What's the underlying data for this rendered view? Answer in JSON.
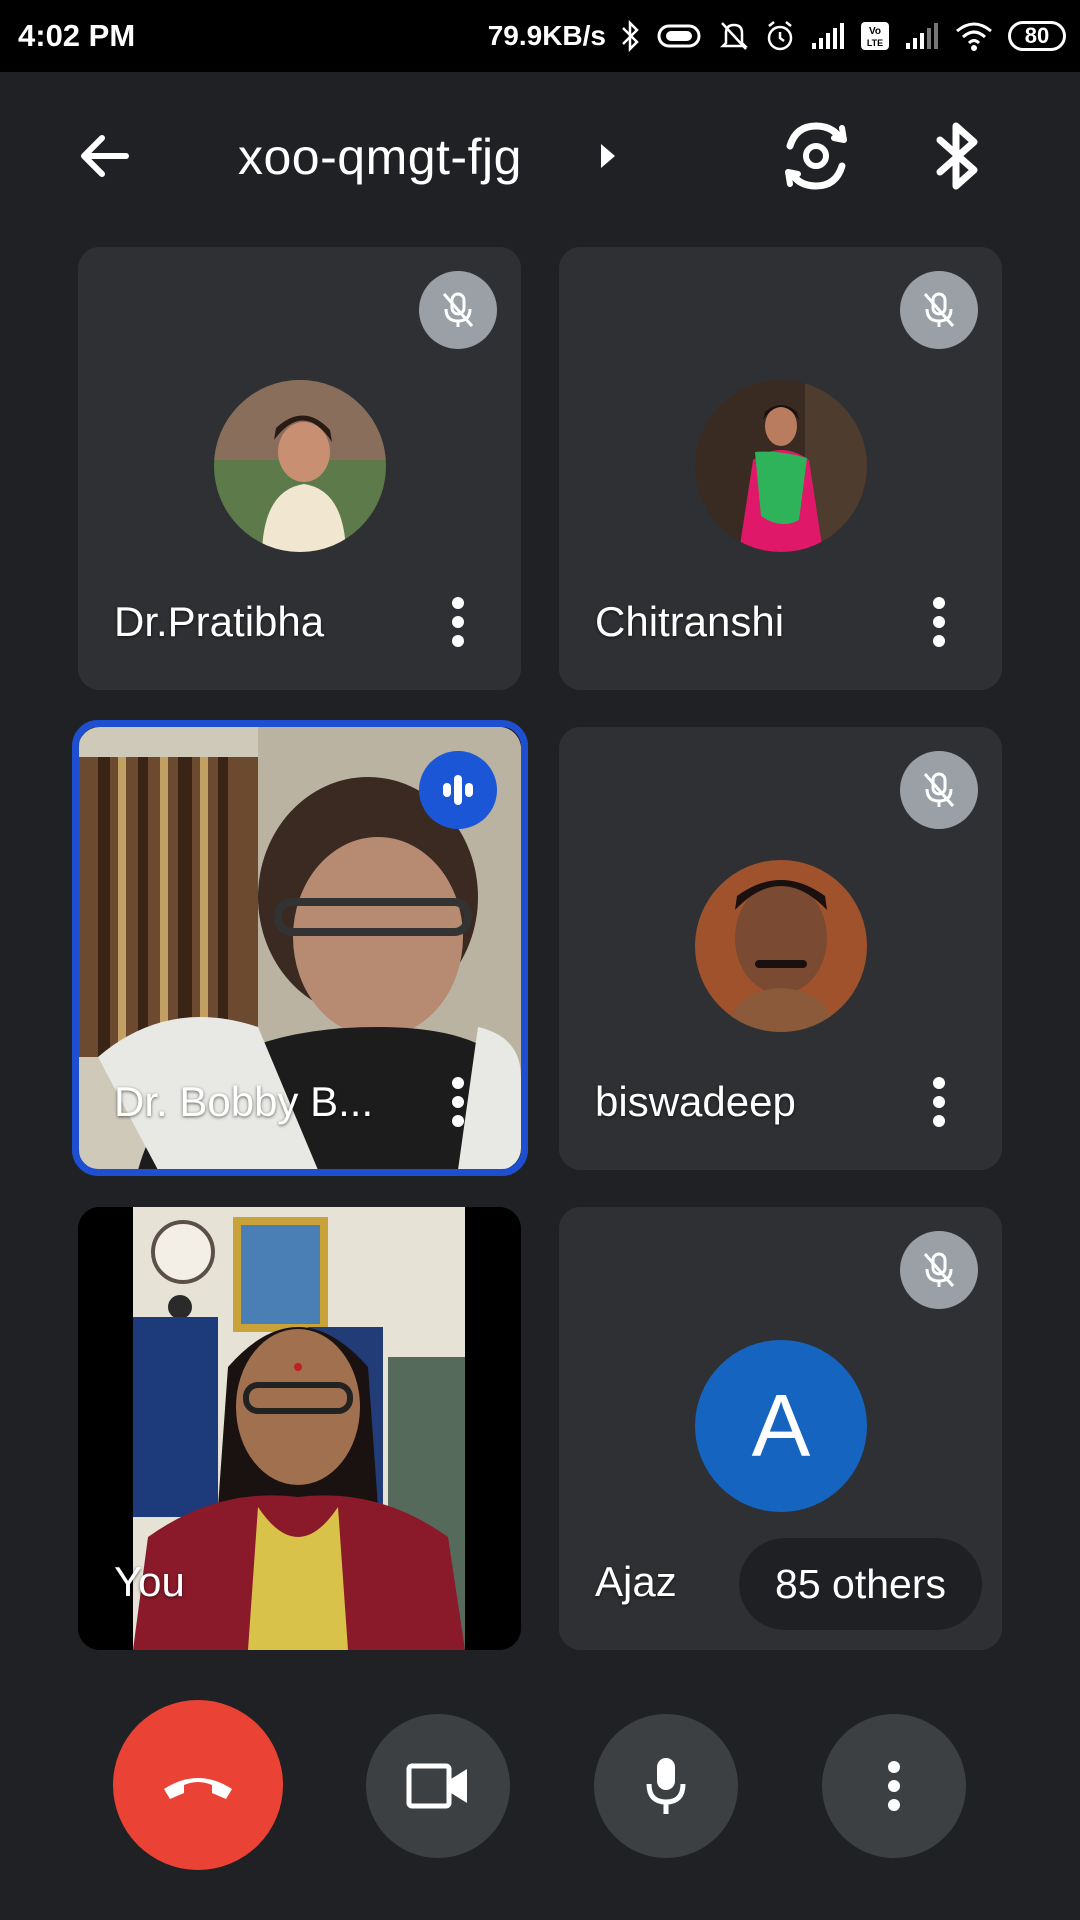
{
  "status_bar": {
    "time": "4:02 PM",
    "net_speed": "79.9KB/s",
    "battery": "80",
    "network_badge": "Vo LTE"
  },
  "header": {
    "meeting_code": "xoo-qmgt-fjg"
  },
  "participants": [
    {
      "name": "Dr.Pratibha",
      "muted": true,
      "avatar": "photo"
    },
    {
      "name": "Chitranshi",
      "muted": true,
      "avatar": "photo"
    },
    {
      "name": "Dr. Bobby B...",
      "muted": false,
      "speaking": true,
      "avatar": "video"
    },
    {
      "name": "biswadeep",
      "muted": true,
      "avatar": "photo"
    },
    {
      "name": "You",
      "avatar": "video"
    },
    {
      "name": "Ajaz",
      "muted": true,
      "avatar_letter": "A",
      "others_label": "85 others"
    }
  ],
  "colors": {
    "background": "#202124",
    "tile": "#3c4043",
    "speaking_border": "#1e4fd1",
    "end_call": "#ea4335",
    "letter_avatar": "#1565c0"
  },
  "icons": [
    "arrow-back-icon",
    "play-arrow-icon",
    "switch-camera-icon",
    "bluetooth-icon",
    "mic-off-icon",
    "more-vert-icon",
    "audio-level-icon",
    "call-end-icon",
    "videocam-icon",
    "mic-icon"
  ]
}
